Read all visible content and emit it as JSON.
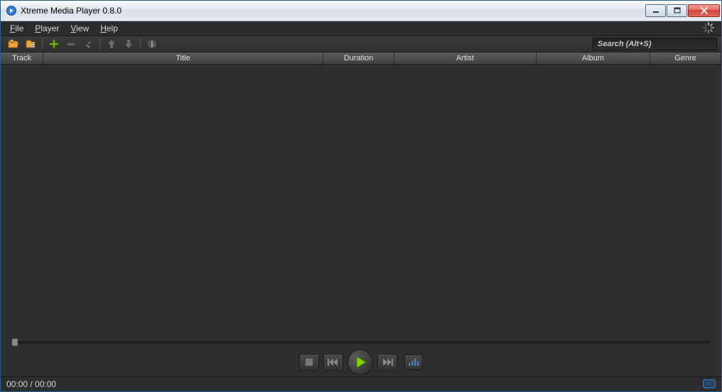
{
  "window": {
    "title": "Xtreme Media Player 0.8.0"
  },
  "menu": {
    "file": "File",
    "player": "Player",
    "view": "View",
    "help": "Help"
  },
  "search": {
    "placeholder": "Search  (Alt+S)"
  },
  "columns": {
    "track": "Track",
    "title": "Title",
    "duration": "Duration",
    "artist": "Artist",
    "album": "Album",
    "genre": "Genre"
  },
  "status": {
    "time": "00:00 / 00:00"
  },
  "colors": {
    "accent_green": "#7fd100",
    "accent_blue": "#2f7ad6"
  }
}
